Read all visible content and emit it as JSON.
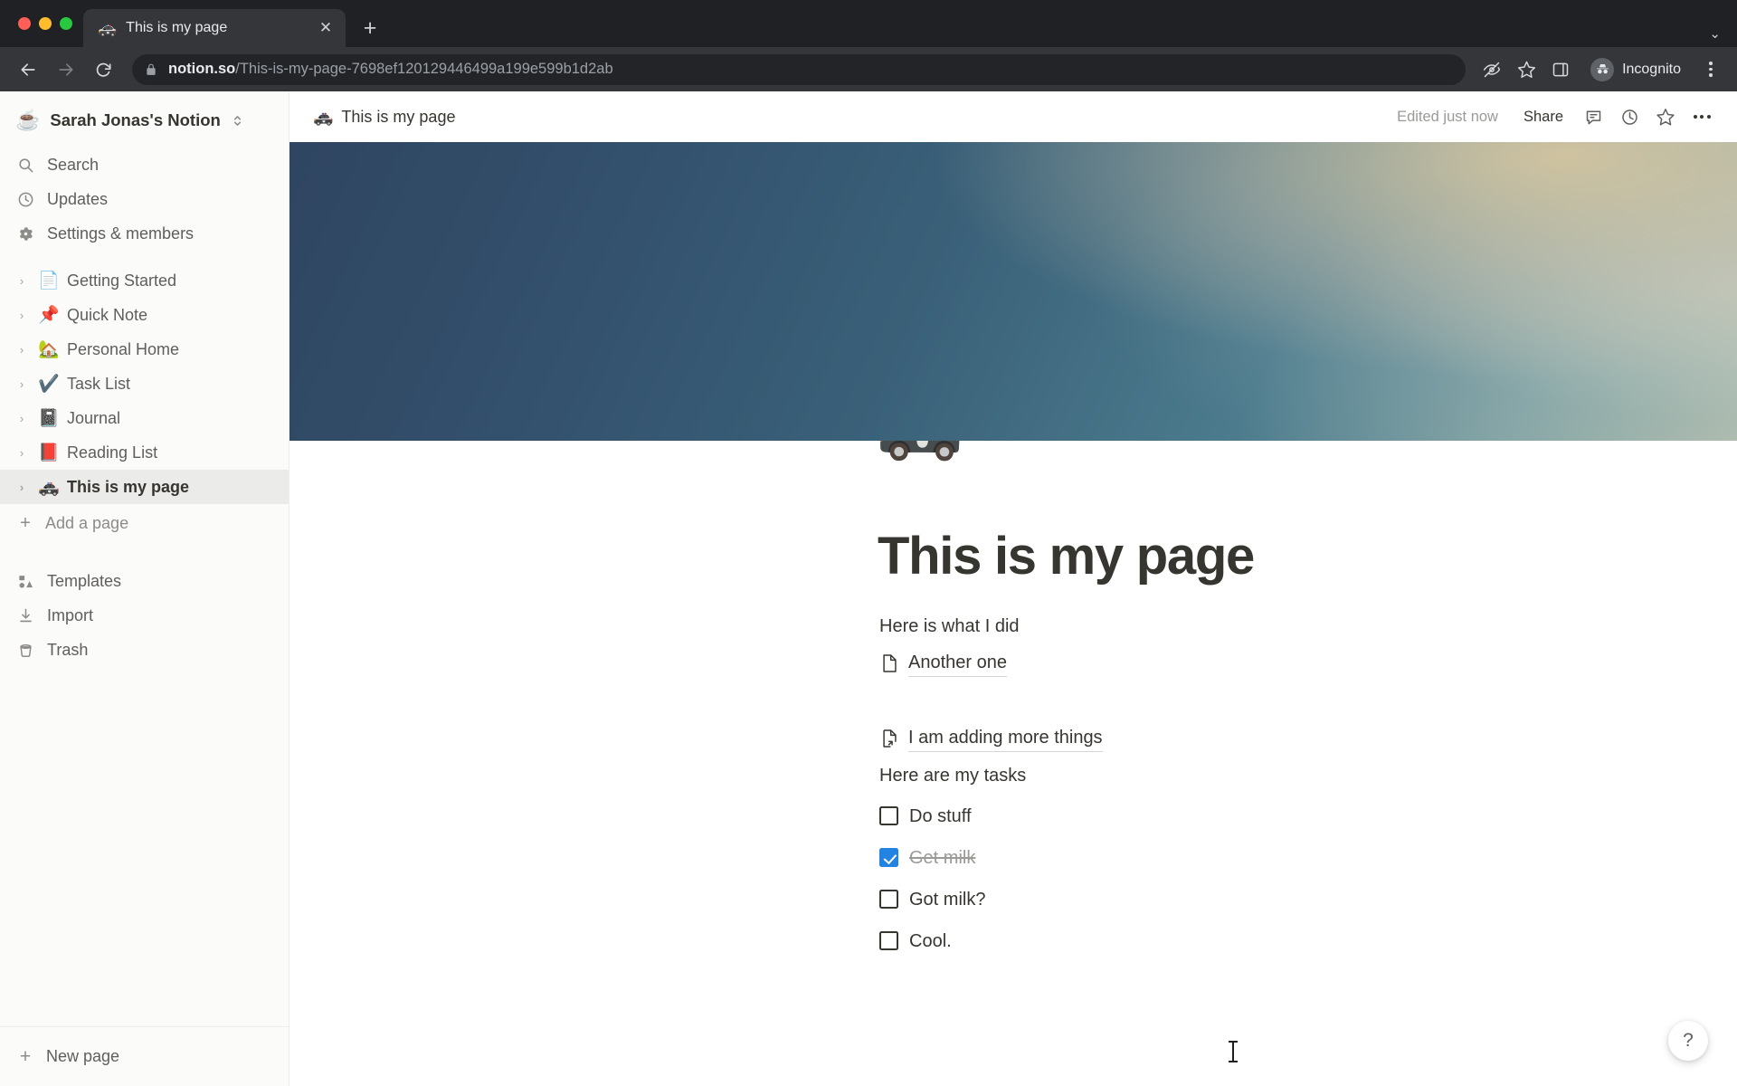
{
  "browser": {
    "tab": {
      "favicon": "🚓",
      "title": "This is my page",
      "close_label": "✕"
    },
    "new_tab_label": "+",
    "tab_list_chevron": "⌄",
    "url": {
      "domain": "notion.so",
      "path": "/This-is-my-page-7698ef120129446499a199e599b1d2ab"
    },
    "profile_label": "Incognito",
    "icons": {
      "back": "back-arrow-icon",
      "forward": "forward-arrow-icon",
      "reload": "reload-icon",
      "lock": "lock-icon",
      "third_party_cookies": "eye-slash-icon",
      "bookmark": "star-icon",
      "side_panel": "side-panel-icon",
      "incognito_avatar": "incognito-avatar-icon",
      "menu": "three-dot-menu-icon"
    }
  },
  "sidebar": {
    "workspace": {
      "emoji": "☕",
      "name": "Sarah Jonas's Notion"
    },
    "nav": [
      {
        "icon": "search-icon",
        "label": "Search"
      },
      {
        "icon": "clock-icon",
        "label": "Updates"
      },
      {
        "icon": "gear-icon",
        "label": "Settings & members"
      }
    ],
    "pages": [
      {
        "emoji": "📄",
        "label": "Getting Started",
        "selected": false
      },
      {
        "emoji": "📌",
        "label": "Quick Note",
        "selected": false
      },
      {
        "emoji": "🏡",
        "label": "Personal Home",
        "selected": false
      },
      {
        "emoji": "✔️",
        "label": "Task List",
        "selected": false
      },
      {
        "emoji": "📓",
        "label": "Journal",
        "selected": false
      },
      {
        "emoji": "📕",
        "label": "Reading List",
        "selected": false
      },
      {
        "emoji": "🚓",
        "label": "This is my page",
        "selected": true
      }
    ],
    "add_page": {
      "icon": "plus-icon",
      "label": "Add a page"
    },
    "utilities": [
      {
        "icon": "templates-icon",
        "label": "Templates"
      },
      {
        "icon": "import-icon",
        "label": "Import"
      },
      {
        "icon": "trash-icon",
        "label": "Trash"
      }
    ],
    "footer": {
      "icon": "plus-icon",
      "label": "New page"
    }
  },
  "topbar": {
    "breadcrumb_emoji": "🚓",
    "breadcrumb_title": "This is my page",
    "edited_status": "Edited just now",
    "share_label": "Share",
    "icons": {
      "comment": "comment-icon",
      "history": "clock-history-icon",
      "favorite": "star-icon",
      "more": "three-dot-menu-icon"
    }
  },
  "page": {
    "cover_colors": {
      "top_left": "#2f4561",
      "mid": "#4c7b8d",
      "warm_highlight": "#d6c6a0",
      "bottom_right": "#b4bfae"
    },
    "emoji": "🚓",
    "title": "This is my page",
    "blocks": [
      {
        "type": "paragraph",
        "text": "Here is what I did"
      },
      {
        "type": "page_link",
        "icon": "blank-page-icon",
        "text": "Another one"
      },
      {
        "type": "spacer"
      },
      {
        "type": "page_link",
        "icon": "page-with-arrow-icon",
        "text": "I am adding more things"
      },
      {
        "type": "paragraph",
        "text": "Here are my tasks"
      }
    ],
    "todos": [
      {
        "text": "Do stuff",
        "checked": false
      },
      {
        "text": "Get milk",
        "checked": true
      },
      {
        "text": "Got milk?",
        "checked": false
      },
      {
        "text": "Cool.",
        "checked": false
      }
    ],
    "accent_color": "#2383e2",
    "help_label": "?"
  }
}
